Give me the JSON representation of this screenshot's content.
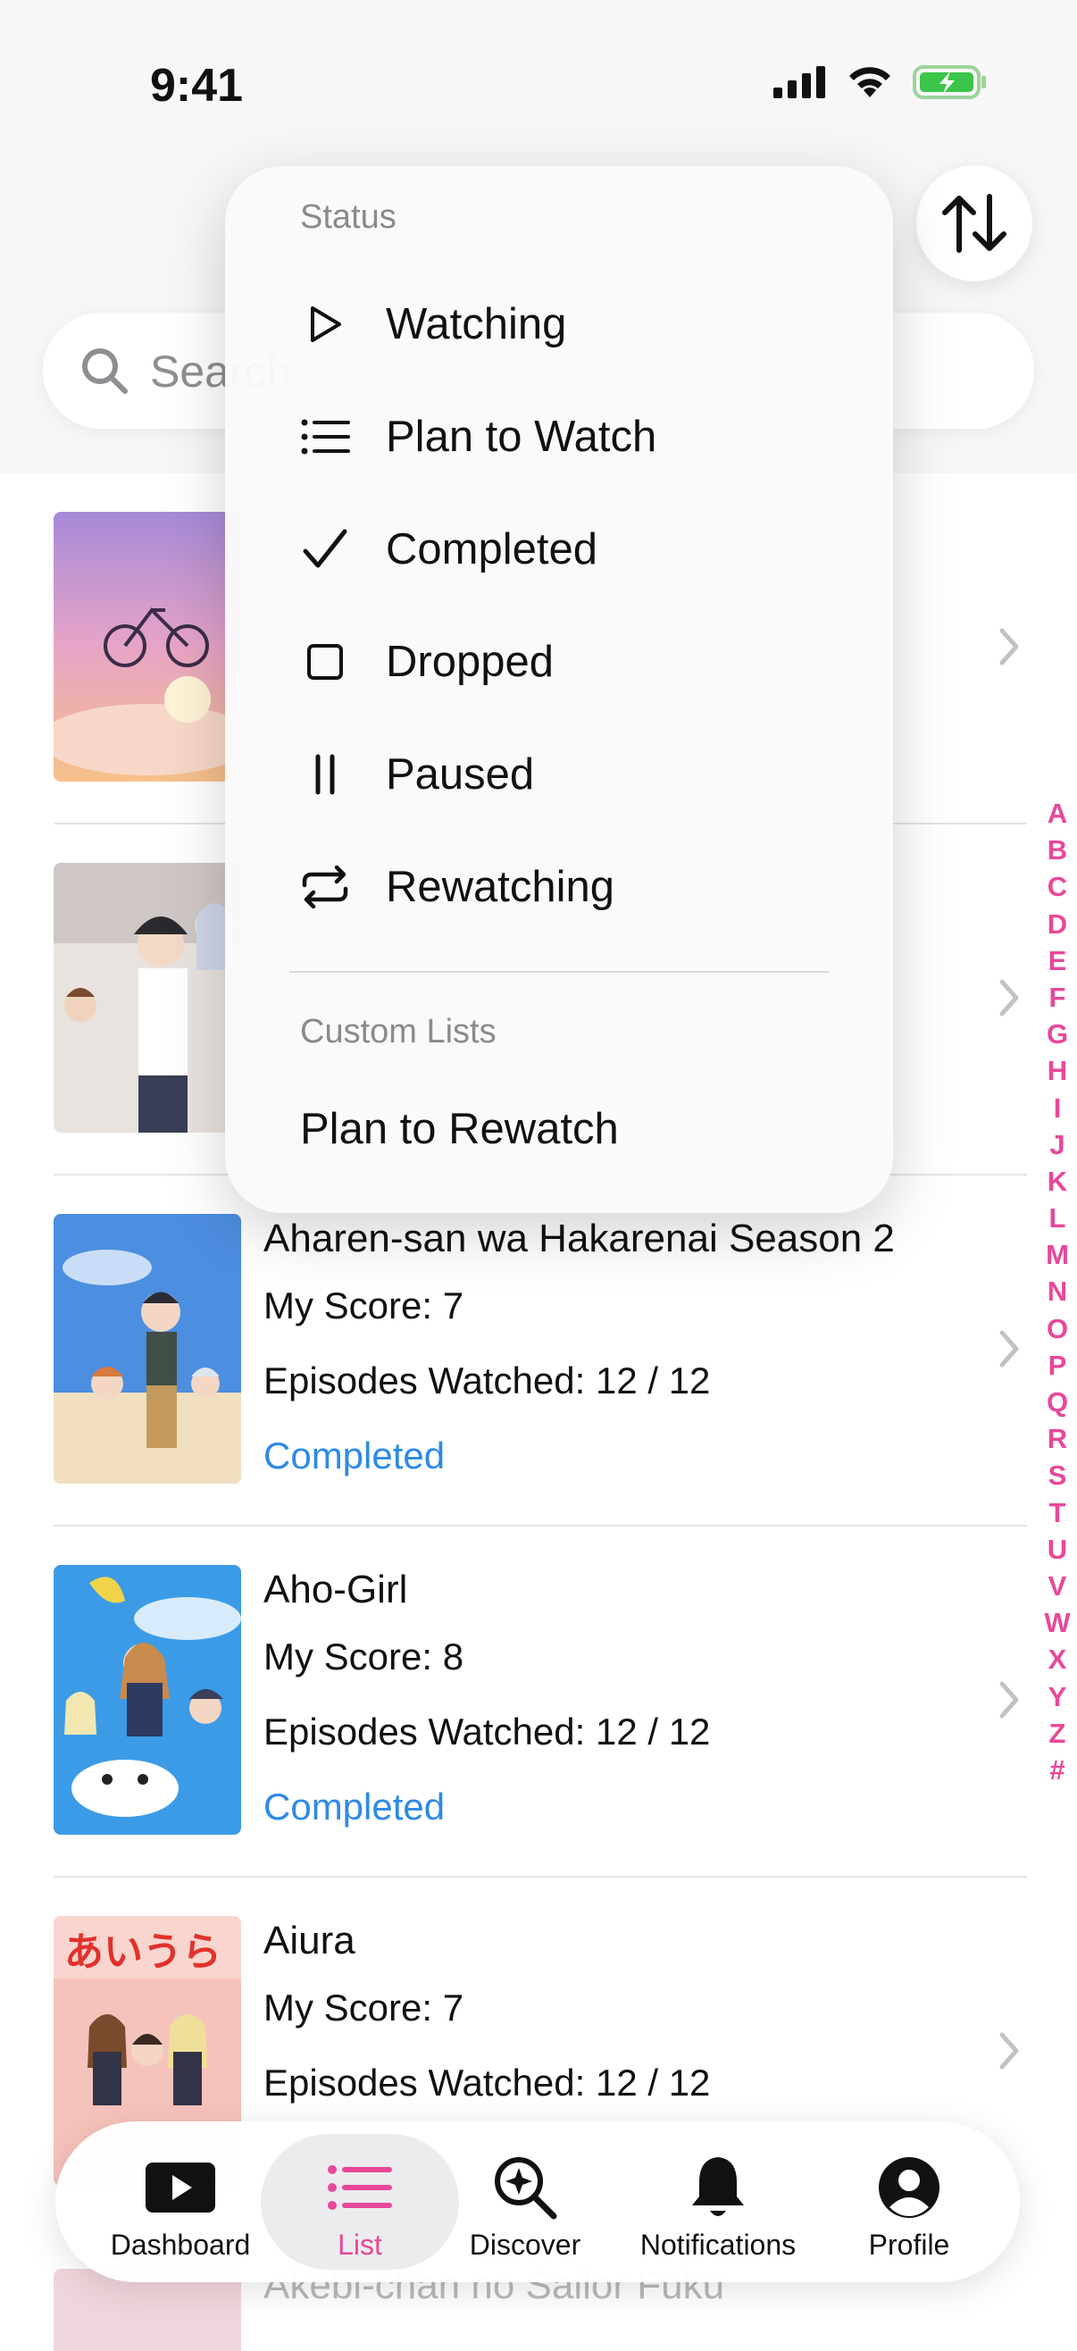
{
  "status_bar": {
    "time": "9:41"
  },
  "search": {
    "placeholder": "Search"
  },
  "sort_button": {
    "icon": "sort-arrows-icon"
  },
  "status_menu": {
    "section_label": "Status",
    "items": [
      {
        "label": "Watching",
        "icon": "play-icon"
      },
      {
        "label": "Plan to Watch",
        "icon": "list-icon"
      },
      {
        "label": "Completed",
        "icon": "checkmark-icon"
      },
      {
        "label": "Dropped",
        "icon": "square-icon"
      },
      {
        "label": "Paused",
        "icon": "pause-icon"
      },
      {
        "label": "Rewatching",
        "icon": "repeat-icon"
      }
    ],
    "custom_section_label": "Custom Lists",
    "custom_items": [
      {
        "label": "Plan to Rewatch"
      }
    ]
  },
  "anime_list": [
    {
      "title": "",
      "score": "",
      "episodes": "",
      "status": ""
    },
    {
      "title": "",
      "score": "",
      "episodes": "",
      "status": ""
    },
    {
      "title": "Aharen-san wa Hakarenai Season 2",
      "score": "My Score: 7",
      "episodes": "Episodes Watched: 12 / 12",
      "status": "Completed"
    },
    {
      "title": "Aho-Girl",
      "score": "My Score: 8",
      "episodes": "Episodes Watched: 12 / 12",
      "status": "Completed"
    },
    {
      "title": "Aiura",
      "score": "My Score: 7",
      "episodes": "Episodes Watched: 12 / 12",
      "status": ""
    },
    {
      "title": "Akebi-chan no Sailor Fuku"
    }
  ],
  "alpha_index": [
    "A",
    "B",
    "C",
    "D",
    "E",
    "F",
    "G",
    "H",
    "I",
    "J",
    "K",
    "L",
    "M",
    "N",
    "O",
    "P",
    "Q",
    "R",
    "S",
    "T",
    "U",
    "V",
    "W",
    "X",
    "Y",
    "Z",
    "#"
  ],
  "tab_bar": {
    "tabs": [
      {
        "label": "Dashboard",
        "icon": "play-rectangle-icon"
      },
      {
        "label": "List",
        "icon": "list-icon",
        "active": true
      },
      {
        "label": "Discover",
        "icon": "magnify-sparkle-icon"
      },
      {
        "label": "Notifications",
        "icon": "bell-icon"
      },
      {
        "label": "Profile",
        "icon": "person-circle-icon"
      }
    ]
  },
  "colors": {
    "accent": "#e8489a",
    "status_blue": "#2f8ae5"
  }
}
